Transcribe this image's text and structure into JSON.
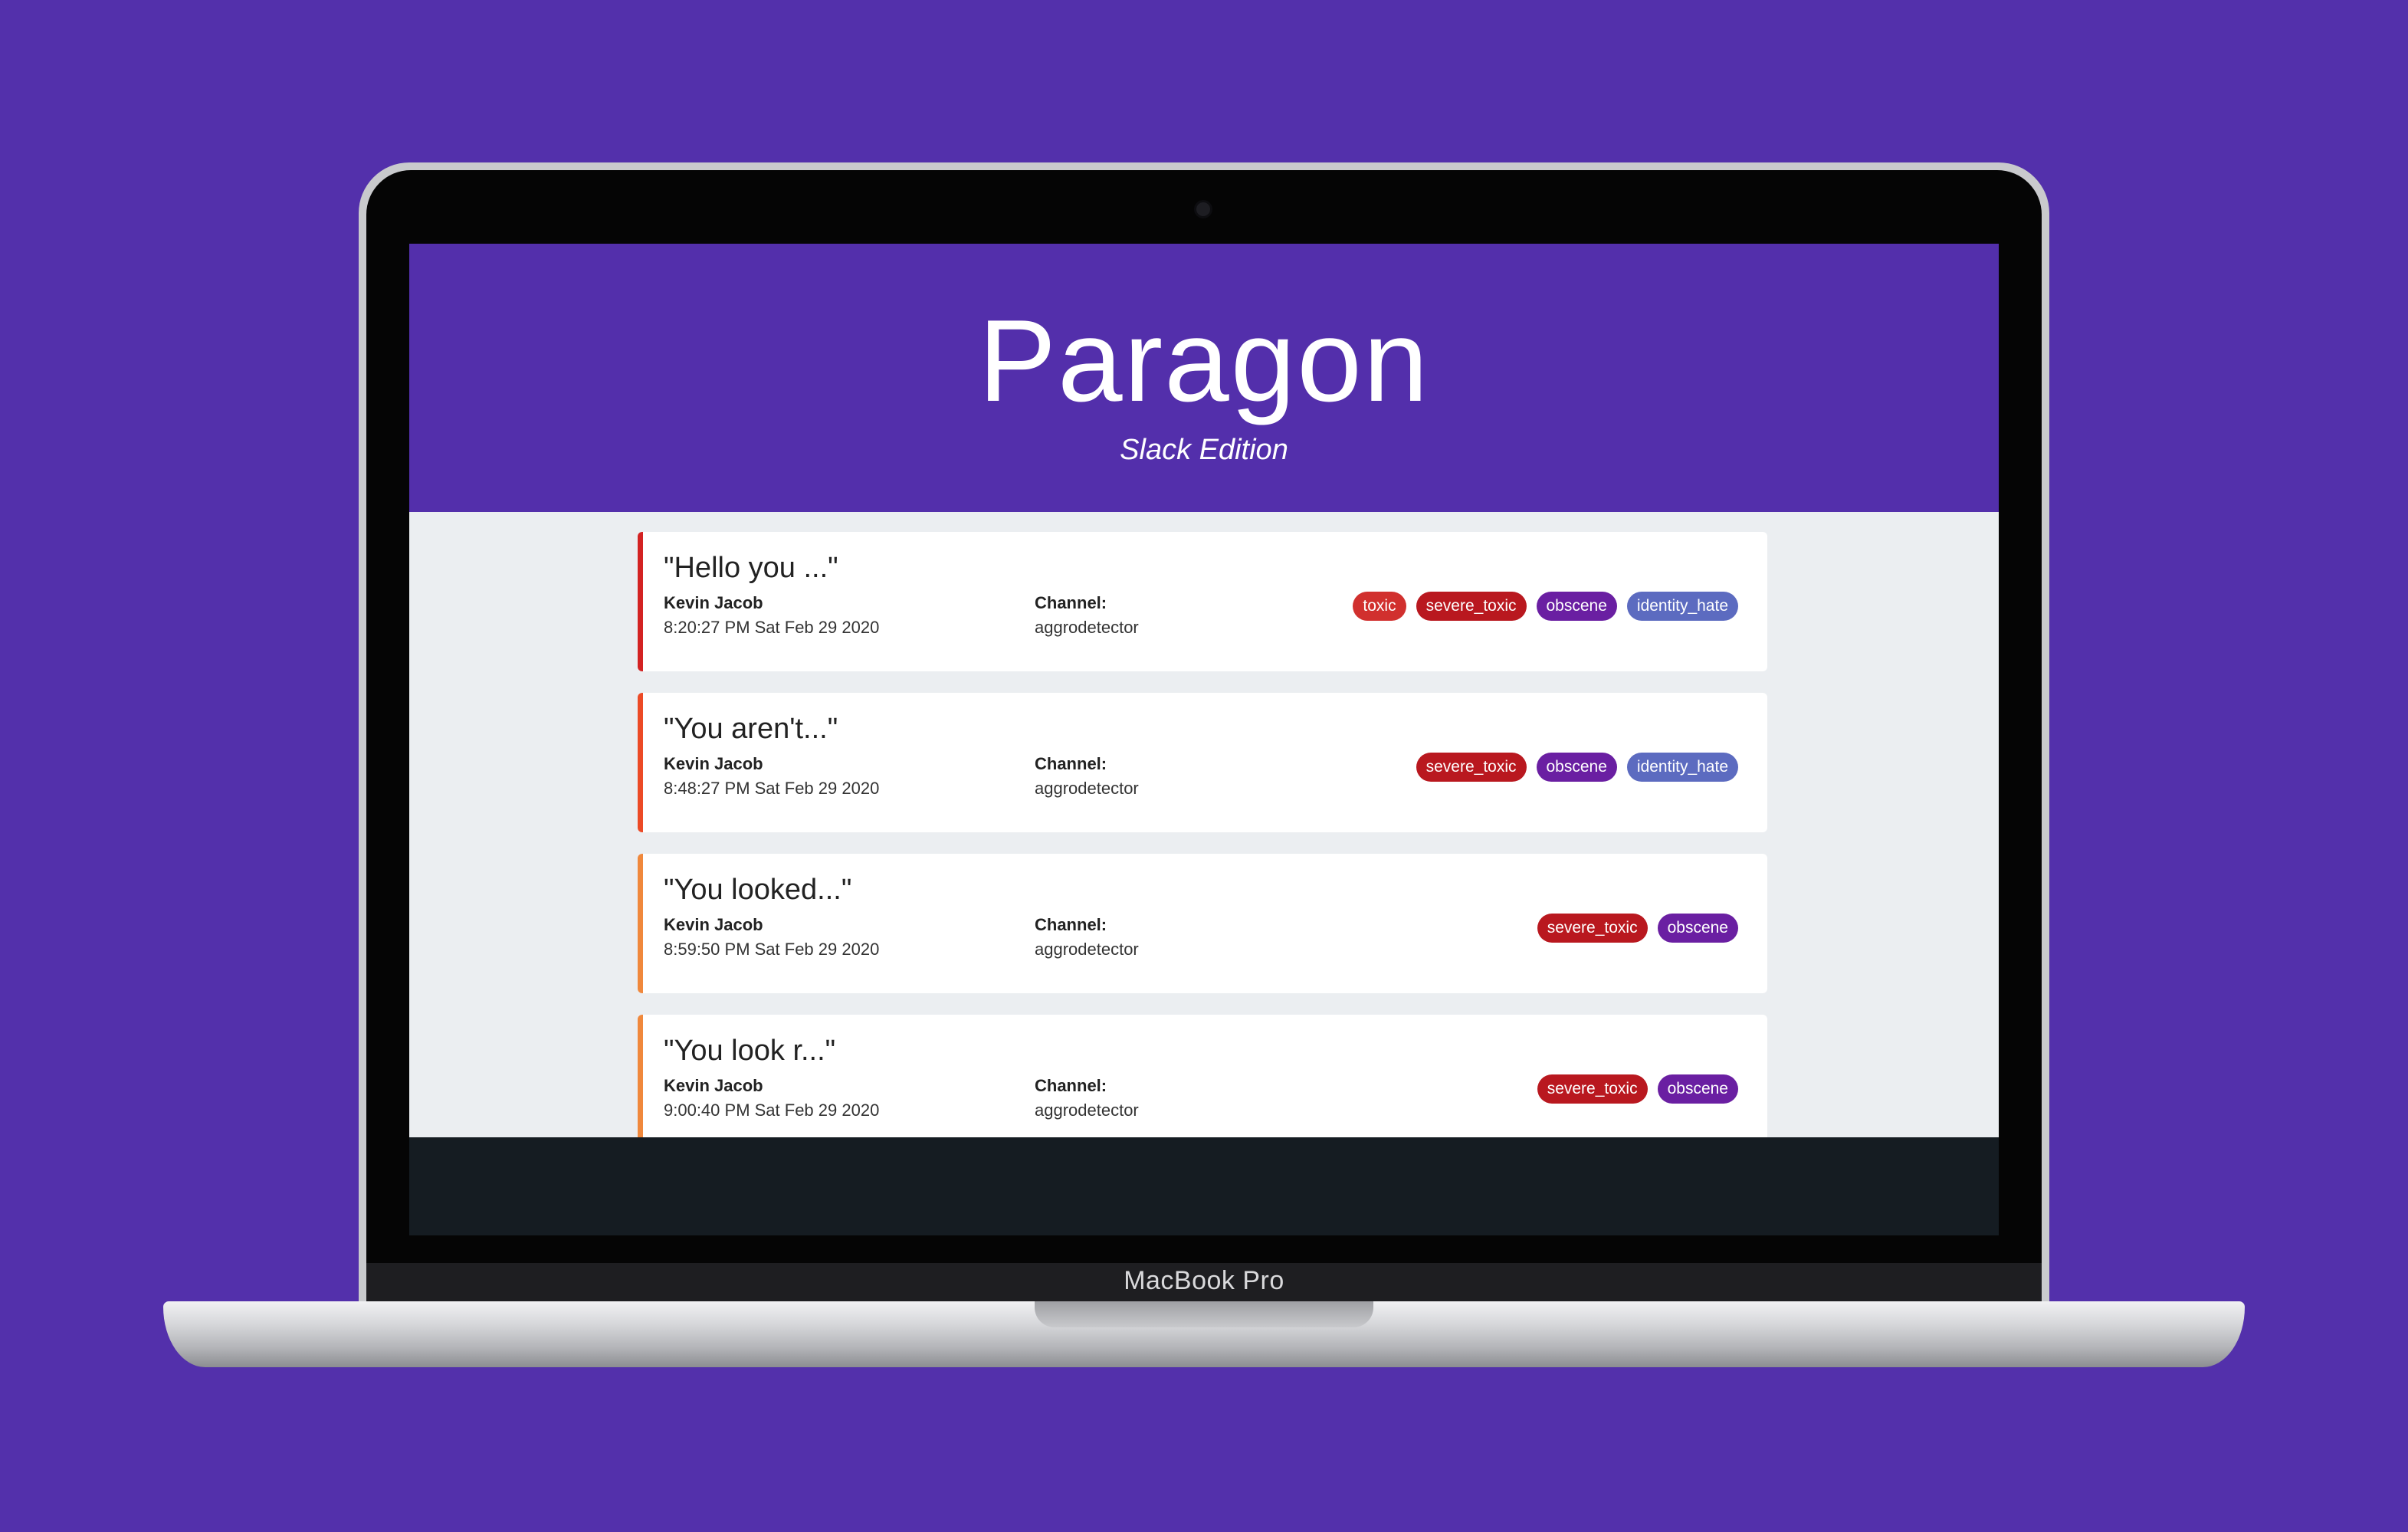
{
  "device": {
    "brand_label": "MacBook Pro"
  },
  "app": {
    "title": "Paragon",
    "subtitle": "Slack Edition"
  },
  "colors": {
    "background": "#5330ab",
    "header": "#532fab",
    "content_bg": "#ebeef1",
    "footer": "#151c22",
    "tag_toxic": "#d1302e",
    "tag_severe_toxic": "#b9181f",
    "tag_obscene": "#6a1fa2",
    "tag_identity_hate": "#5c6bc0"
  },
  "messages": [
    {
      "text": "\"Hello you ...\"",
      "author": "Kevin Jacob",
      "timestamp": "8:20:27 PM Sat Feb 29 2020",
      "channel_label": "Channel:",
      "channel": "aggrodetector",
      "severity_color": "#d32222",
      "tags": [
        "toxic",
        "severe_toxic",
        "obscene",
        "identity_hate"
      ]
    },
    {
      "text": "\"You aren't...\"",
      "author": "Kevin Jacob",
      "timestamp": "8:48:27 PM Sat Feb 29 2020",
      "channel_label": "Channel:",
      "channel": "aggrodetector",
      "severity_color": "#ec4a26",
      "tags": [
        "severe_toxic",
        "obscene",
        "identity_hate"
      ]
    },
    {
      "text": "\"You looked...\"",
      "author": "Kevin Jacob",
      "timestamp": "8:59:50 PM Sat Feb 29 2020",
      "channel_label": "Channel:",
      "channel": "aggrodetector",
      "severity_color": "#f0883c",
      "tags": [
        "severe_toxic",
        "obscene"
      ]
    },
    {
      "text": "\"You look r...\"",
      "author": "Kevin Jacob",
      "timestamp": "9:00:40 PM Sat Feb 29 2020",
      "channel_label": "Channel:",
      "channel": "aggrodetector",
      "severity_color": "#f0883c",
      "tags": [
        "severe_toxic",
        "obscene"
      ]
    }
  ]
}
